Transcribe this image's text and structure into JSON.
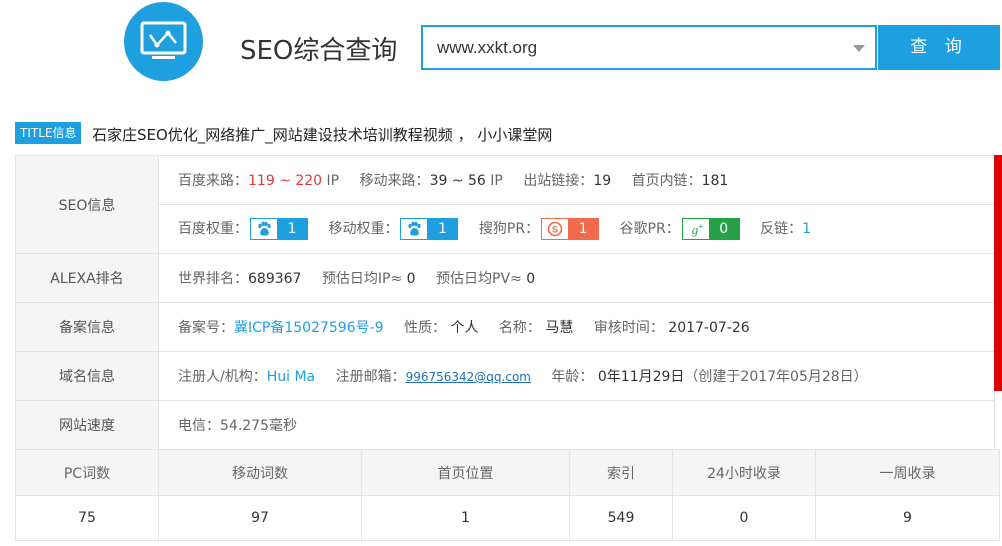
{
  "header": {
    "logo_icon": "chart-monitor-icon",
    "title": "SEO综合查询",
    "search_value": "www.xxkt.org",
    "search_button": "查 询"
  },
  "title_row": {
    "badge": "TITLE信息",
    "text": "石家庄SEO优化_网络推广_网站建设技术培训教程视频 ， 小小课堂网"
  },
  "seo": {
    "label": "SEO信息",
    "baidu_traffic_label": "百度来路：",
    "baidu_traffic_value": "119 ~ 220",
    "baidu_traffic_unit": "IP",
    "mobile_traffic_label": "移动来路：",
    "mobile_traffic_value": "39 ~ 56",
    "mobile_traffic_unit": "IP",
    "outlinks_label": "出站链接：",
    "outlinks_value": "19",
    "homepage_links_label": "首页内链：",
    "homepage_links_value": "181",
    "baidu_weight_label": "百度权重：",
    "baidu_weight_value": "1",
    "mobile_weight_label": "移动权重：",
    "mobile_weight_value": "1",
    "sogou_pr_label": "搜狗PR：",
    "sogou_pr_value": "1",
    "google_pr_label": "谷歌PR：",
    "google_pr_value": "0",
    "backlinks_label": "反链：",
    "backlinks_value": "1"
  },
  "alexa": {
    "label": "ALEXA排名",
    "world_rank_label": "世界排名：",
    "world_rank_value": "689367",
    "daily_ip_label": "预估日均IP≈",
    "daily_ip_value": "0",
    "daily_pv_label": "预估日均PV≈",
    "daily_pv_value": "0"
  },
  "icp": {
    "label": "备案信息",
    "number_label": "备案号：",
    "number_value": "冀ICP备15027596号-9",
    "nature_label": "性质：",
    "nature_value": "个人",
    "name_label": "名称：",
    "name_value": "马慧",
    "review_label": "审核时间：",
    "review_value": "2017-07-26"
  },
  "domain": {
    "label": "域名信息",
    "registrant_label": "注册人/机构：",
    "registrant_value": "Hui Ma",
    "email_label": "注册邮箱：",
    "email_value": "996756342@qq.com",
    "age_label": "年龄：",
    "age_value": "0年11月29日",
    "created_value": "（创建于2017年05月28日）"
  },
  "speed": {
    "label": "网站速度",
    "value": "电信：54.275毫秒"
  },
  "stats": {
    "headers": [
      "PC词数",
      "移动词数",
      "首页位置",
      "索引",
      "24小时收录",
      "一周收录"
    ],
    "values": [
      "75",
      "97",
      "1",
      "549",
      "0",
      "9"
    ]
  },
  "colors": {
    "accent": "#1e9fe0",
    "red": "#e4393c",
    "sogou": "#f26a4b",
    "google": "#27a147"
  }
}
